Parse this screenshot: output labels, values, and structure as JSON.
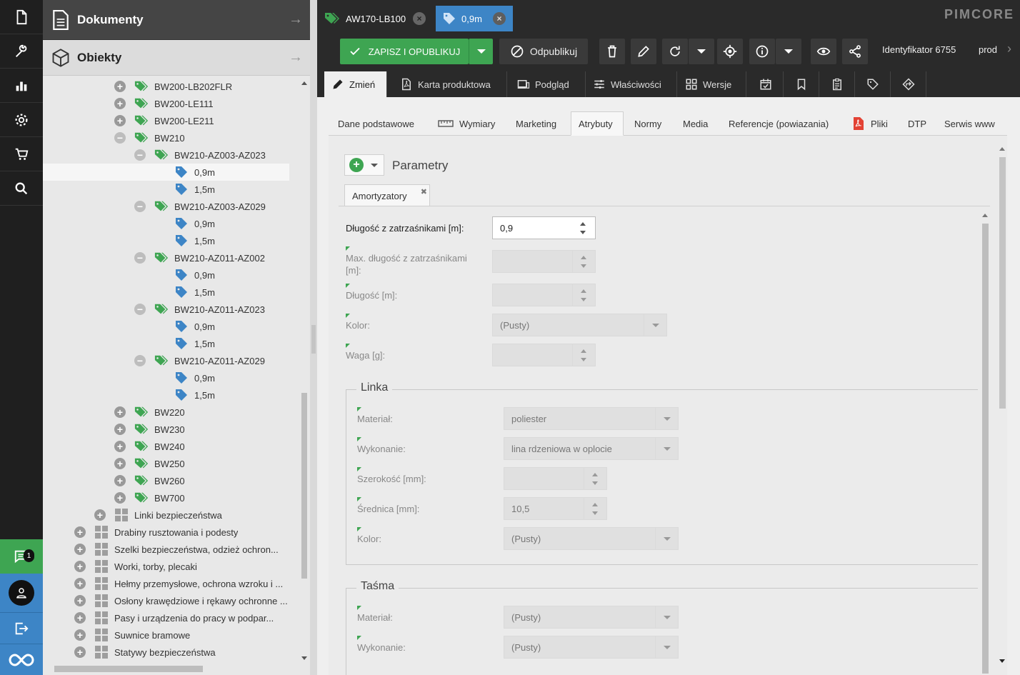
{
  "panels": {
    "documents": "Dokumenty",
    "objects": "Obiekty"
  },
  "tree": [
    {
      "indent": 100,
      "toggle": "plus",
      "icon": "tag-green-icon",
      "label": "BW200-LB202FLR"
    },
    {
      "indent": 100,
      "toggle": "plus",
      "icon": "tag-green-icon",
      "label": "BW200-LE111"
    },
    {
      "indent": 100,
      "toggle": "plus",
      "icon": "tag-green-icon",
      "label": "BW200-LE211"
    },
    {
      "indent": 100,
      "toggle": "minus",
      "icon": "tag-green-icon",
      "label": "BW210"
    },
    {
      "indent": 128,
      "toggle": "minus",
      "icon": "tag-green-icon",
      "label": "BW210-AZ003-AZ023"
    },
    {
      "indent": 156,
      "toggle": "none",
      "icon": "tag-blue-icon",
      "label": "0,9m",
      "selected": true
    },
    {
      "indent": 156,
      "toggle": "none",
      "icon": "tag-blue-icon",
      "label": "1,5m"
    },
    {
      "indent": 128,
      "toggle": "minus",
      "icon": "tag-green-icon",
      "label": "BW210-AZ003-AZ029"
    },
    {
      "indent": 156,
      "toggle": "none",
      "icon": "tag-blue-icon",
      "label": "0,9m"
    },
    {
      "indent": 156,
      "toggle": "none",
      "icon": "tag-blue-icon",
      "label": "1,5m"
    },
    {
      "indent": 128,
      "toggle": "minus",
      "icon": "tag-green-icon",
      "label": "BW210-AZ011-AZ002"
    },
    {
      "indent": 156,
      "toggle": "none",
      "icon": "tag-blue-icon",
      "label": "0,9m"
    },
    {
      "indent": 156,
      "toggle": "none",
      "icon": "tag-blue-icon",
      "label": "1,5m"
    },
    {
      "indent": 128,
      "toggle": "minus",
      "icon": "tag-green-icon",
      "label": "BW210-AZ011-AZ023"
    },
    {
      "indent": 156,
      "toggle": "none",
      "icon": "tag-blue-icon",
      "label": "0,9m"
    },
    {
      "indent": 156,
      "toggle": "none",
      "icon": "tag-blue-icon",
      "label": "1,5m"
    },
    {
      "indent": 128,
      "toggle": "minus",
      "icon": "tag-green-icon",
      "label": "BW210-AZ011-AZ029"
    },
    {
      "indent": 156,
      "toggle": "none",
      "icon": "tag-blue-icon",
      "label": "0,9m"
    },
    {
      "indent": 156,
      "toggle": "none",
      "icon": "tag-blue-icon",
      "label": "1,5m"
    },
    {
      "indent": 100,
      "toggle": "plus",
      "icon": "tag-green-icon",
      "label": "BW220"
    },
    {
      "indent": 100,
      "toggle": "plus",
      "icon": "tag-green-icon",
      "label": "BW230"
    },
    {
      "indent": 100,
      "toggle": "plus",
      "icon": "tag-green-icon",
      "label": "BW240"
    },
    {
      "indent": 100,
      "toggle": "plus",
      "icon": "tag-green-icon",
      "label": "BW250"
    },
    {
      "indent": 100,
      "toggle": "plus",
      "icon": "tag-green-icon",
      "label": "BW260"
    },
    {
      "indent": 100,
      "toggle": "plus",
      "icon": "tag-green-icon",
      "label": "BW700"
    },
    {
      "indent": 72,
      "toggle": "plus",
      "icon": "grid-folder-icon",
      "label": "Linki bezpieczeństwa"
    },
    {
      "indent": 44,
      "toggle": "plus",
      "icon": "grid-folder-icon",
      "label": "Drabiny rusztowania i podesty"
    },
    {
      "indent": 44,
      "toggle": "plus",
      "icon": "grid-folder-icon",
      "label": "Szelki bezpieczeństwa, odzież ochron..."
    },
    {
      "indent": 44,
      "toggle": "plus",
      "icon": "grid-folder-icon",
      "label": "Worki, torby, plecaki"
    },
    {
      "indent": 44,
      "toggle": "plus",
      "icon": "grid-folder-icon",
      "label": "Hełmy przemysłowe, ochrona wzroku i ..."
    },
    {
      "indent": 44,
      "toggle": "plus",
      "icon": "grid-folder-icon",
      "label": "Osłony krawędziowe i rękawy ochronne ..."
    },
    {
      "indent": 44,
      "toggle": "plus",
      "icon": "grid-folder-icon",
      "label": "Pasy i urządzenia do pracy w podpar..."
    },
    {
      "indent": 44,
      "toggle": "plus",
      "icon": "grid-folder-icon",
      "label": "Suwnice bramowe"
    },
    {
      "indent": 44,
      "toggle": "plus",
      "icon": "grid-folder-icon",
      "label": "Statywy bezpieczeństwa"
    }
  ],
  "notifications": {
    "count": "1"
  },
  "doc_tabs": [
    {
      "label": "AW170-LB100"
    },
    {
      "label": "0,9m"
    }
  ],
  "brand": "PIMCORE",
  "toolbar": {
    "save_publish": "ZAPISZ I OPUBLIKUJ",
    "unpublish": "Odpublikuj",
    "identifier": "Identyfikator 6755",
    "env": "prod"
  },
  "edit_tabs": [
    "Zmień",
    "Karta produktowa",
    "Podgląd",
    "Właściwości",
    "Wersje"
  ],
  "sub_tabs": [
    "Dane podstawowe",
    "Wymiary",
    "Marketing",
    "Atrybuty",
    "Normy",
    "Media",
    "Referencje (powiazania)",
    "Pliki",
    "DTP",
    "Serwis www"
  ],
  "params": {
    "title": "Parametry",
    "tab": "Amortyzatory",
    "fields": {
      "dl_zatrz": {
        "label": "Długość z zatrzaśnikami [m]:",
        "value": "0,9"
      },
      "max_dl": {
        "label": "Max. długość z zatrzaśnikami [m]:",
        "value": ""
      },
      "dlugosc": {
        "label": "Długość [m]:",
        "value": ""
      },
      "kolor": {
        "label": "Kolor:",
        "value": "(Pusty)"
      },
      "waga": {
        "label": "Waga [g]:",
        "value": ""
      }
    },
    "linka": {
      "legend": "Linka",
      "material": {
        "label": "Materiał:",
        "value": "poliester"
      },
      "wykonanie": {
        "label": "Wykonanie:",
        "value": "lina rdzeniowa w oplocie"
      },
      "szerokosc": {
        "label": "Szerokość [mm]:",
        "value": ""
      },
      "srednica": {
        "label": "Średnica [mm]:",
        "value": "10,5"
      },
      "kolor": {
        "label": "Kolor:",
        "value": "(Pusty)"
      }
    },
    "tasma": {
      "legend": "Taśma",
      "material": {
        "label": "Materiał:",
        "value": "(Pusty)"
      },
      "wykonanie": {
        "label": "Wykonanie:",
        "value": "(Pusty)"
      }
    }
  }
}
